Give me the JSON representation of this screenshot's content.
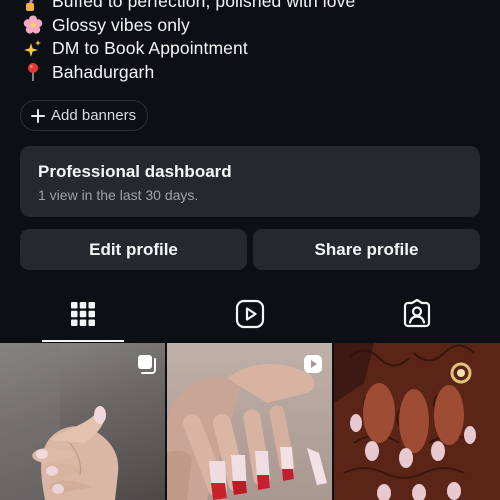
{
  "bio": {
    "lines": [
      {
        "icon": "nail-polish-icon",
        "text": "Buffed to perfection, polished with love"
      },
      {
        "icon": "cherry-blossom-icon",
        "text": "Glossy vibes only"
      },
      {
        "icon": "sparkles-icon",
        "text": "DM to Book Appointment"
      },
      {
        "icon": "map-pin-icon",
        "text": "Bahadurgarh"
      }
    ]
  },
  "add_banners": {
    "label": "Add banners"
  },
  "dashboard": {
    "title": "Professional dashboard",
    "subtitle": "1 view in the last 30 days."
  },
  "actions": {
    "edit_label": "Edit profile",
    "share_label": "Share profile"
  },
  "tabs": [
    {
      "icon": "grid-icon",
      "selected": true
    },
    {
      "icon": "reels-icon",
      "selected": false
    },
    {
      "icon": "tagged-icon",
      "selected": false
    }
  ],
  "posts": [
    {
      "badge": "carousel-icon",
      "content": "hand with pink french-tip nails"
    },
    {
      "badge": "reel-icon",
      "content": "hands with red heart nail art"
    },
    {
      "badge": "none",
      "content": "hand with mehndi and gold ring"
    }
  ],
  "colors": {
    "background": "#0c1014",
    "card": "#25292e",
    "text": "#f5f5f5",
    "muted": "#9ea3aa"
  }
}
